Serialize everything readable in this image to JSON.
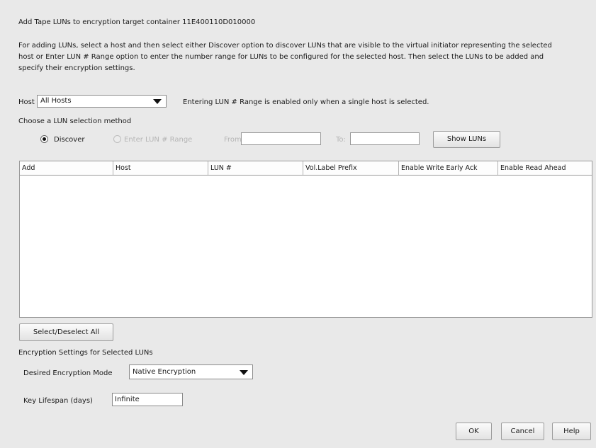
{
  "dialog": {
    "title": "Add Tape LUNs to encryption target container 11E400110D010000",
    "description": "For adding LUNs, select a host and then select either Discover option to discover LUNs that are visible to the virtual initiator representing the selected host or Enter LUN # Range option to enter the number range for LUNs to be configured for the selected host. Then select the LUNs to be added and specify their encryption settings."
  },
  "host": {
    "label": "Host",
    "selected": "All Hosts",
    "note": "Entering LUN # Range is enabled only when a single host is selected."
  },
  "lun_selection": {
    "label": "Choose a LUN selection method",
    "discover_label": "Discover",
    "range_label": "Enter LUN # Range",
    "from_label": "From:",
    "from_value": "",
    "to_label": "To:",
    "to_value": "",
    "show_luns_label": "Show LUNs",
    "selected_method": "Discover"
  },
  "table": {
    "columns": [
      "Add",
      "Host",
      "LUN #",
      "Vol.Label Prefix",
      "Enable Write Early Ack",
      "Enable Read Ahead"
    ],
    "rows": []
  },
  "select_all_label": "Select/Deselect All",
  "encryption": {
    "section_label": "Encryption Settings for Selected LUNs",
    "mode_label": "Desired Encryption Mode",
    "mode_value": "Native Encryption",
    "lifespan_label": "Key Lifespan (days)",
    "lifespan_value": "Infinite"
  },
  "footer": {
    "ok_label": "OK",
    "cancel_label": "Cancel",
    "help_label": "Help"
  }
}
